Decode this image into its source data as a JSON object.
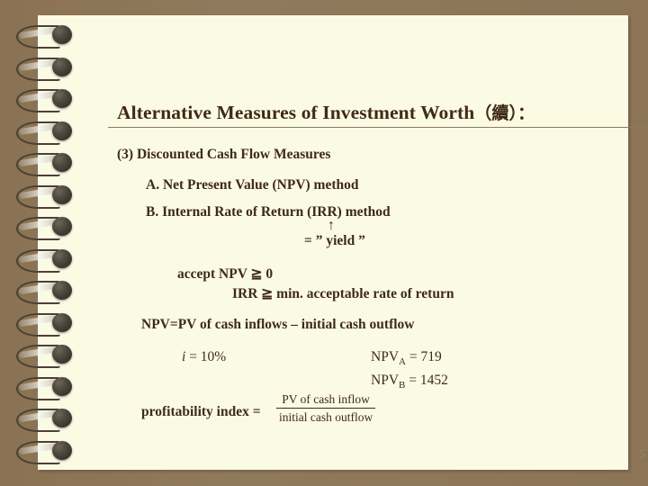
{
  "slide": {
    "page_number": "5",
    "colors": {
      "board_background": "#8b7355",
      "page_background": "#fbfbe4",
      "text": "#3f2a17",
      "rule": "#8a7a5e",
      "page_number": "#8d8a5c"
    },
    "title": {
      "main": "Alternative Measures of Investment Worth",
      "cjk_suffix": "（續）",
      "colon": "："
    },
    "body": {
      "heading": "(3) Discounted Cash Flow Measures",
      "item_a": "A. Net Present Value (NPV) method",
      "item_b": "B. Internal Rate of Return (IRR) method",
      "arrow_icon": "↑",
      "yield_note": "= ” yield ”",
      "accept_npv": "accept  NPV  ≧ 0",
      "accept_irr": "IRR ≧ min. acceptable rate of return",
      "npv_definition": "NPV=PV of cash inflows – initial cash outflow",
      "interest_rate_symbol": "i",
      "interest_rate_value": "= 10%",
      "npv_a_label": "NPV",
      "npv_a_sub": "A",
      "npv_a_value": "= 719",
      "npv_b_label": "NPV",
      "npv_b_sub": "B",
      "npv_b_value": "= 1452",
      "profitability_index_label": "profitability index =",
      "fraction_numerator": "PV of cash inflow",
      "fraction_denominator": "initial cash outflow"
    },
    "binding": {
      "coil_count": 14,
      "label": "spiral-binding"
    }
  }
}
